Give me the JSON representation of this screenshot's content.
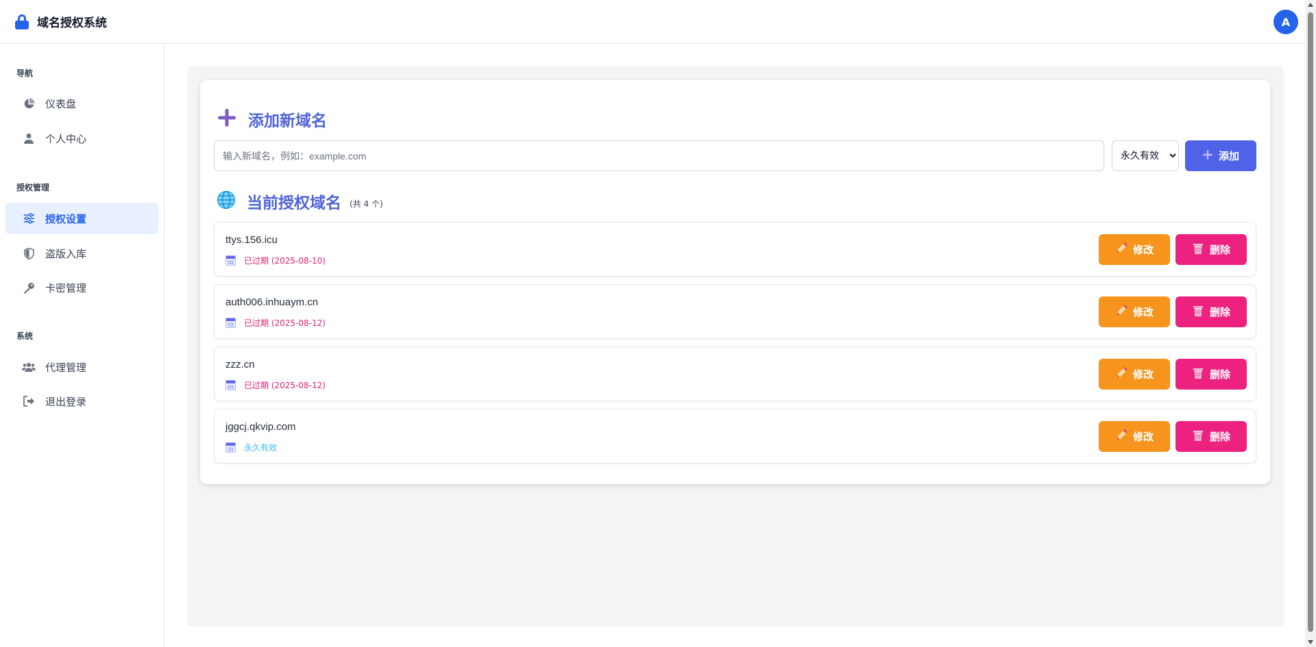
{
  "header": {
    "app_title": "域名授权系统",
    "avatar_initial": "A"
  },
  "sidebar": {
    "sections": [
      {
        "title": "导航"
      },
      {
        "title": "授权管理"
      },
      {
        "title": "系统"
      }
    ],
    "items": [
      {
        "label": "仪表盘",
        "icon": "pie-chart-icon"
      },
      {
        "label": "个人中心",
        "icon": "user-icon"
      },
      {
        "label": "授权设置",
        "icon": "sliders-icon",
        "active": true
      },
      {
        "label": "盗版入库",
        "icon": "shield-icon"
      },
      {
        "label": "卡密管理",
        "icon": "key-icon"
      },
      {
        "label": "代理管理",
        "icon": "users-icon"
      },
      {
        "label": "退出登录",
        "icon": "logout-icon"
      }
    ]
  },
  "add_section": {
    "title": "添加新域名",
    "input_placeholder": "输入新域名，例如：example.com",
    "input_value": "",
    "duration_selected": "永久有效",
    "add_label": "添加"
  },
  "list_section": {
    "title": "当前授权域名",
    "count_note": "(共 4 个)"
  },
  "domains": [
    {
      "name": "ttys.156.icu",
      "status": "已过期 (2025-08-10)",
      "state": "expired"
    },
    {
      "name": "auth006.inhuaym.cn",
      "status": "已过期 (2025-08-12)",
      "state": "expired"
    },
    {
      "name": "zzz.cn",
      "status": "已过期 (2025-08-12)",
      "state": "expired"
    },
    {
      "name": "jggcj.qkvip.com",
      "status": "永久有效",
      "state": "permanent"
    }
  ],
  "row_actions": {
    "edit_label": "修改",
    "delete_label": "删除"
  },
  "colors": {
    "primary": "#2563eb",
    "accent_title": "#4f63d9",
    "edit": "#f7941d",
    "delete": "#ec2180",
    "expired": "#e11d74",
    "permanent": "#38bdf8"
  }
}
